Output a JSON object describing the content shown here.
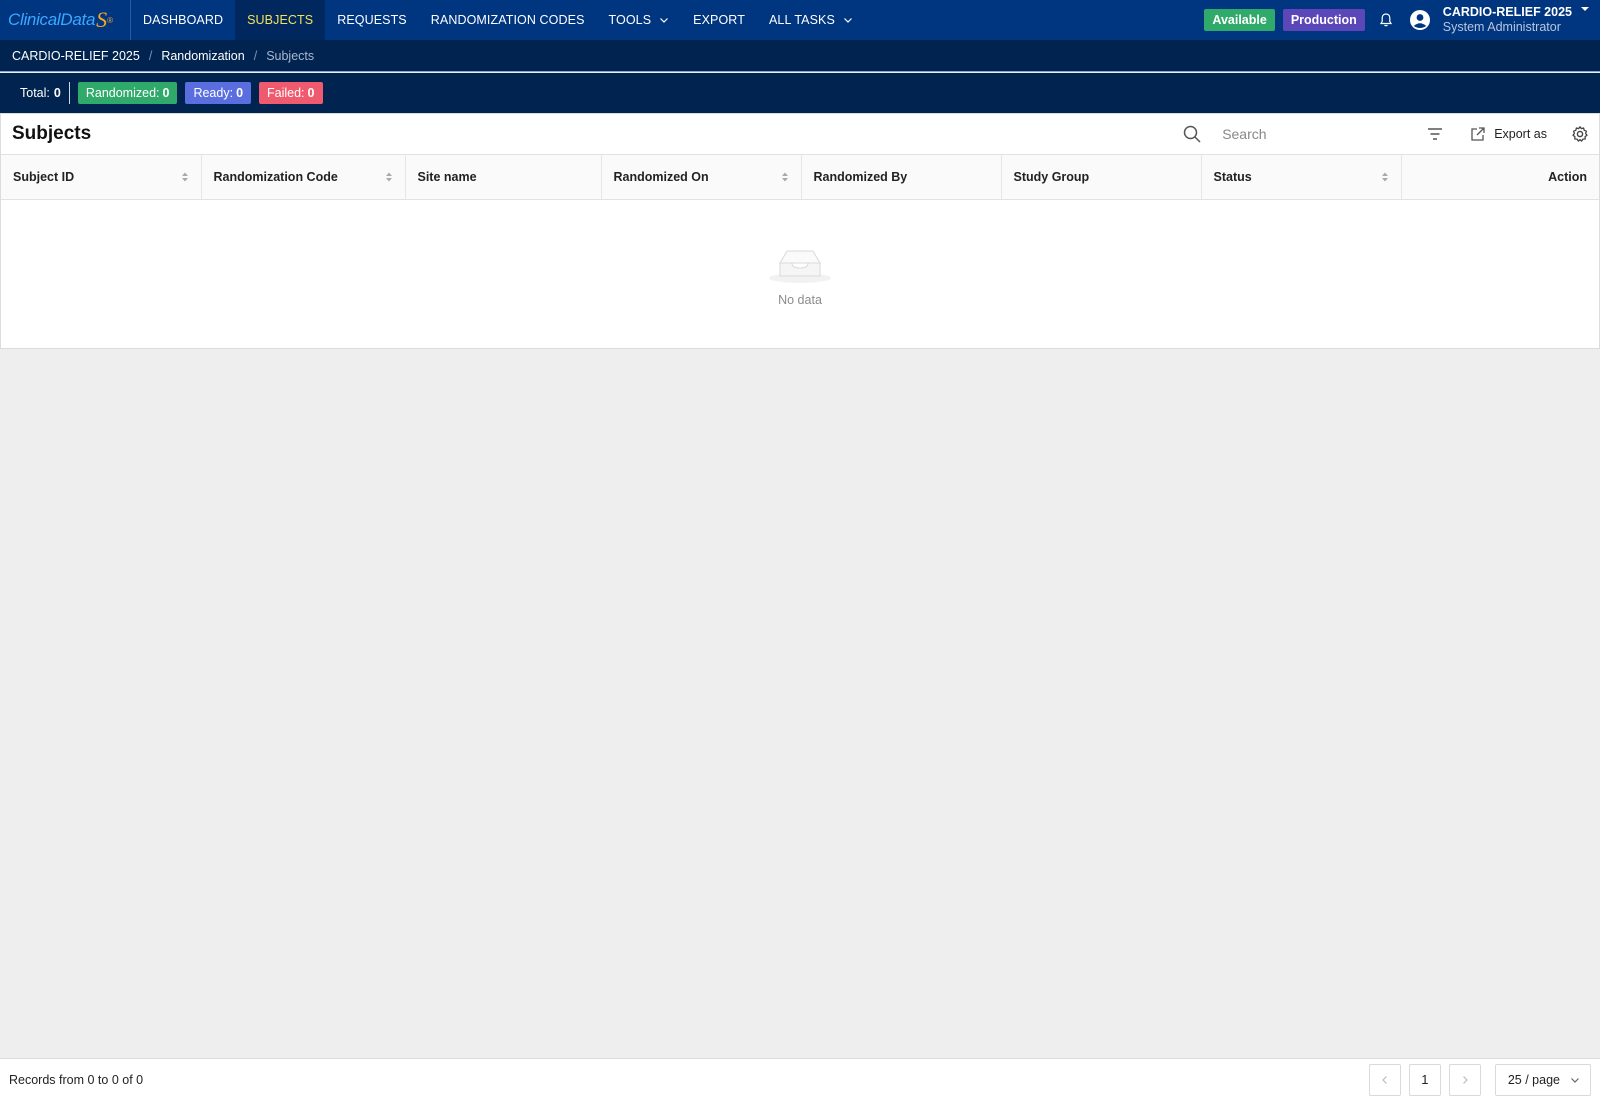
{
  "brand": {
    "logo_text": "ClinicalData",
    "logo_mark": "S",
    "logo_reg": "®"
  },
  "nav": {
    "items": [
      {
        "label": "DASHBOARD",
        "active": false
      },
      {
        "label": "SUBJECTS",
        "active": true
      },
      {
        "label": "REQUESTS",
        "active": false
      },
      {
        "label": "RANDOMIZATION CODES",
        "active": false
      },
      {
        "label": "TOOLS",
        "active": false,
        "dropdown": true
      },
      {
        "label": "EXPORT",
        "active": false
      },
      {
        "label": "ALL TASKS",
        "active": false,
        "dropdown": true
      }
    ]
  },
  "topbar": {
    "available_label": "Available",
    "environment_label": "Production",
    "study_name": "CARDIO-RELIEF 2025",
    "user_role": "System Administrator",
    "icons": [
      "bell-icon",
      "user-avatar-icon",
      "caret-down-icon"
    ]
  },
  "breadcrumb": [
    "CARDIO-RELIEF 2025",
    "Randomization",
    "Subjects"
  ],
  "stats": {
    "total_label": "Total:",
    "total_value": "0",
    "randomized_label": "Randomized:",
    "randomized_value": "0",
    "ready_label": "Ready:",
    "ready_value": "0",
    "failed_label": "Failed:",
    "failed_value": "0"
  },
  "panel": {
    "title": "Subjects",
    "search_placeholder": "Search",
    "export_label": "Export as"
  },
  "table": {
    "columns": [
      "Subject ID",
      "Randomization Code",
      "Site name",
      "Randomized On",
      "Randomized By",
      "Study Group",
      "Status",
      "Action"
    ],
    "sortable": [
      true,
      true,
      false,
      true,
      false,
      false,
      true,
      false
    ],
    "rows": [],
    "empty_text": "No data"
  },
  "footer": {
    "records_text": "Records from 0 to 0 of 0",
    "current_page": "1",
    "page_size": "25 / page"
  },
  "colors": {
    "nav_bg": "#003580",
    "subbar_bg": "#00234f",
    "active_nav_text": "#f3e25a",
    "available": "#2faa6a",
    "production": "#5c47b8",
    "randomized": "#2faa6a",
    "ready": "#5b6ee0",
    "failed": "#ef5a6e"
  }
}
